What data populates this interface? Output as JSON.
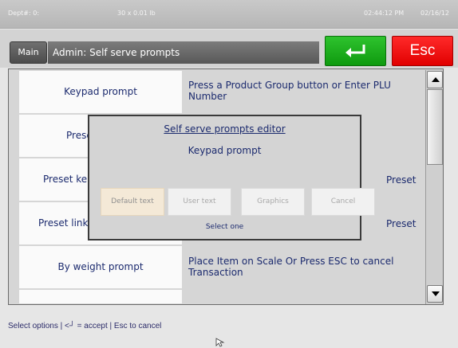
{
  "status": {
    "dept": "Dept#: 0:",
    "weight": "30 x 0.01 lb",
    "time": "02:44:12 PM",
    "date": "02/16/12"
  },
  "header": {
    "main_button": "Main",
    "title": "Admin: Self serve prompts",
    "esc_button": "Esc",
    "enter_icon": "enter-arrow-icon"
  },
  "prompts": [
    {
      "name": "Keypad prompt",
      "description": "Press a Product Group button or Enter PLU Number"
    },
    {
      "name": "Prese",
      "description": ""
    },
    {
      "name": "Preset ke",
      "description": "Preset"
    },
    {
      "name": "Preset link",
      "description": "Preset"
    },
    {
      "name": "By weight prompt",
      "description": "Place Item on Scale Or Press ESC to cancel Transaction"
    }
  ],
  "modal": {
    "title": "Self serve prompts editor",
    "subtitle": "Keypad prompt",
    "buttons": [
      "Default text",
      "User text",
      "Graphics",
      "Cancel"
    ],
    "footer": "Select one"
  },
  "hint": "Select options | <┘ = accept | Esc to cancel",
  "colors": {
    "accept": "#1fae1f",
    "escape": "#f20000",
    "text": "#1b2a6e"
  }
}
